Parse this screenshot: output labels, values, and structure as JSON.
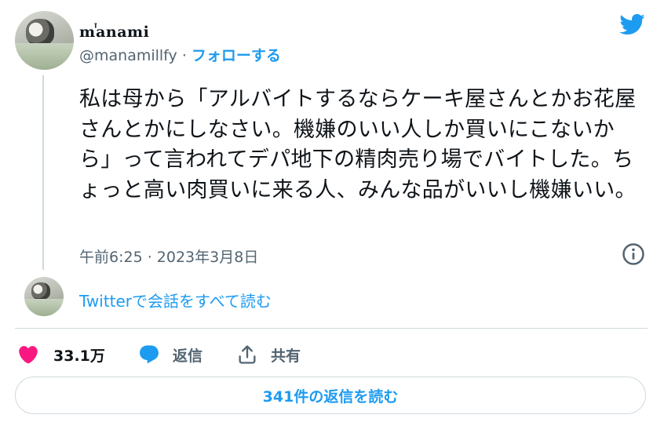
{
  "author": {
    "display_name": "mꙶanami",
    "handle": "@manamillfy",
    "separator": " · ",
    "follow_label": "フォローする"
  },
  "tweet": {
    "text": "私は母から「アルバイトするならケーキ屋さんとかお花屋さんとかにしなさい。機嫌のいい人しか買いにこないから」って言われてデパ地下の精肉売り場でバイトした。ちょっと高い肉買いに来る人、みんな品がいいし機嫌いい。",
    "timestamp": "午前6:25 · 2023年3月8日"
  },
  "conversation_link": "Twitterで会話をすべて読む",
  "actions": {
    "like_count": "33.1万",
    "reply_label": "返信",
    "share_label": "共有"
  },
  "replies_button": "341件の返信を読む",
  "colors": {
    "accent": "#1d9bf0",
    "like": "#f91880",
    "text": "#0f1419",
    "secondary": "#536471",
    "border": "#cfd9de"
  },
  "icons": [
    "twitter-bird-icon",
    "info-icon",
    "heart-icon",
    "reply-bubble-icon",
    "share-icon"
  ]
}
